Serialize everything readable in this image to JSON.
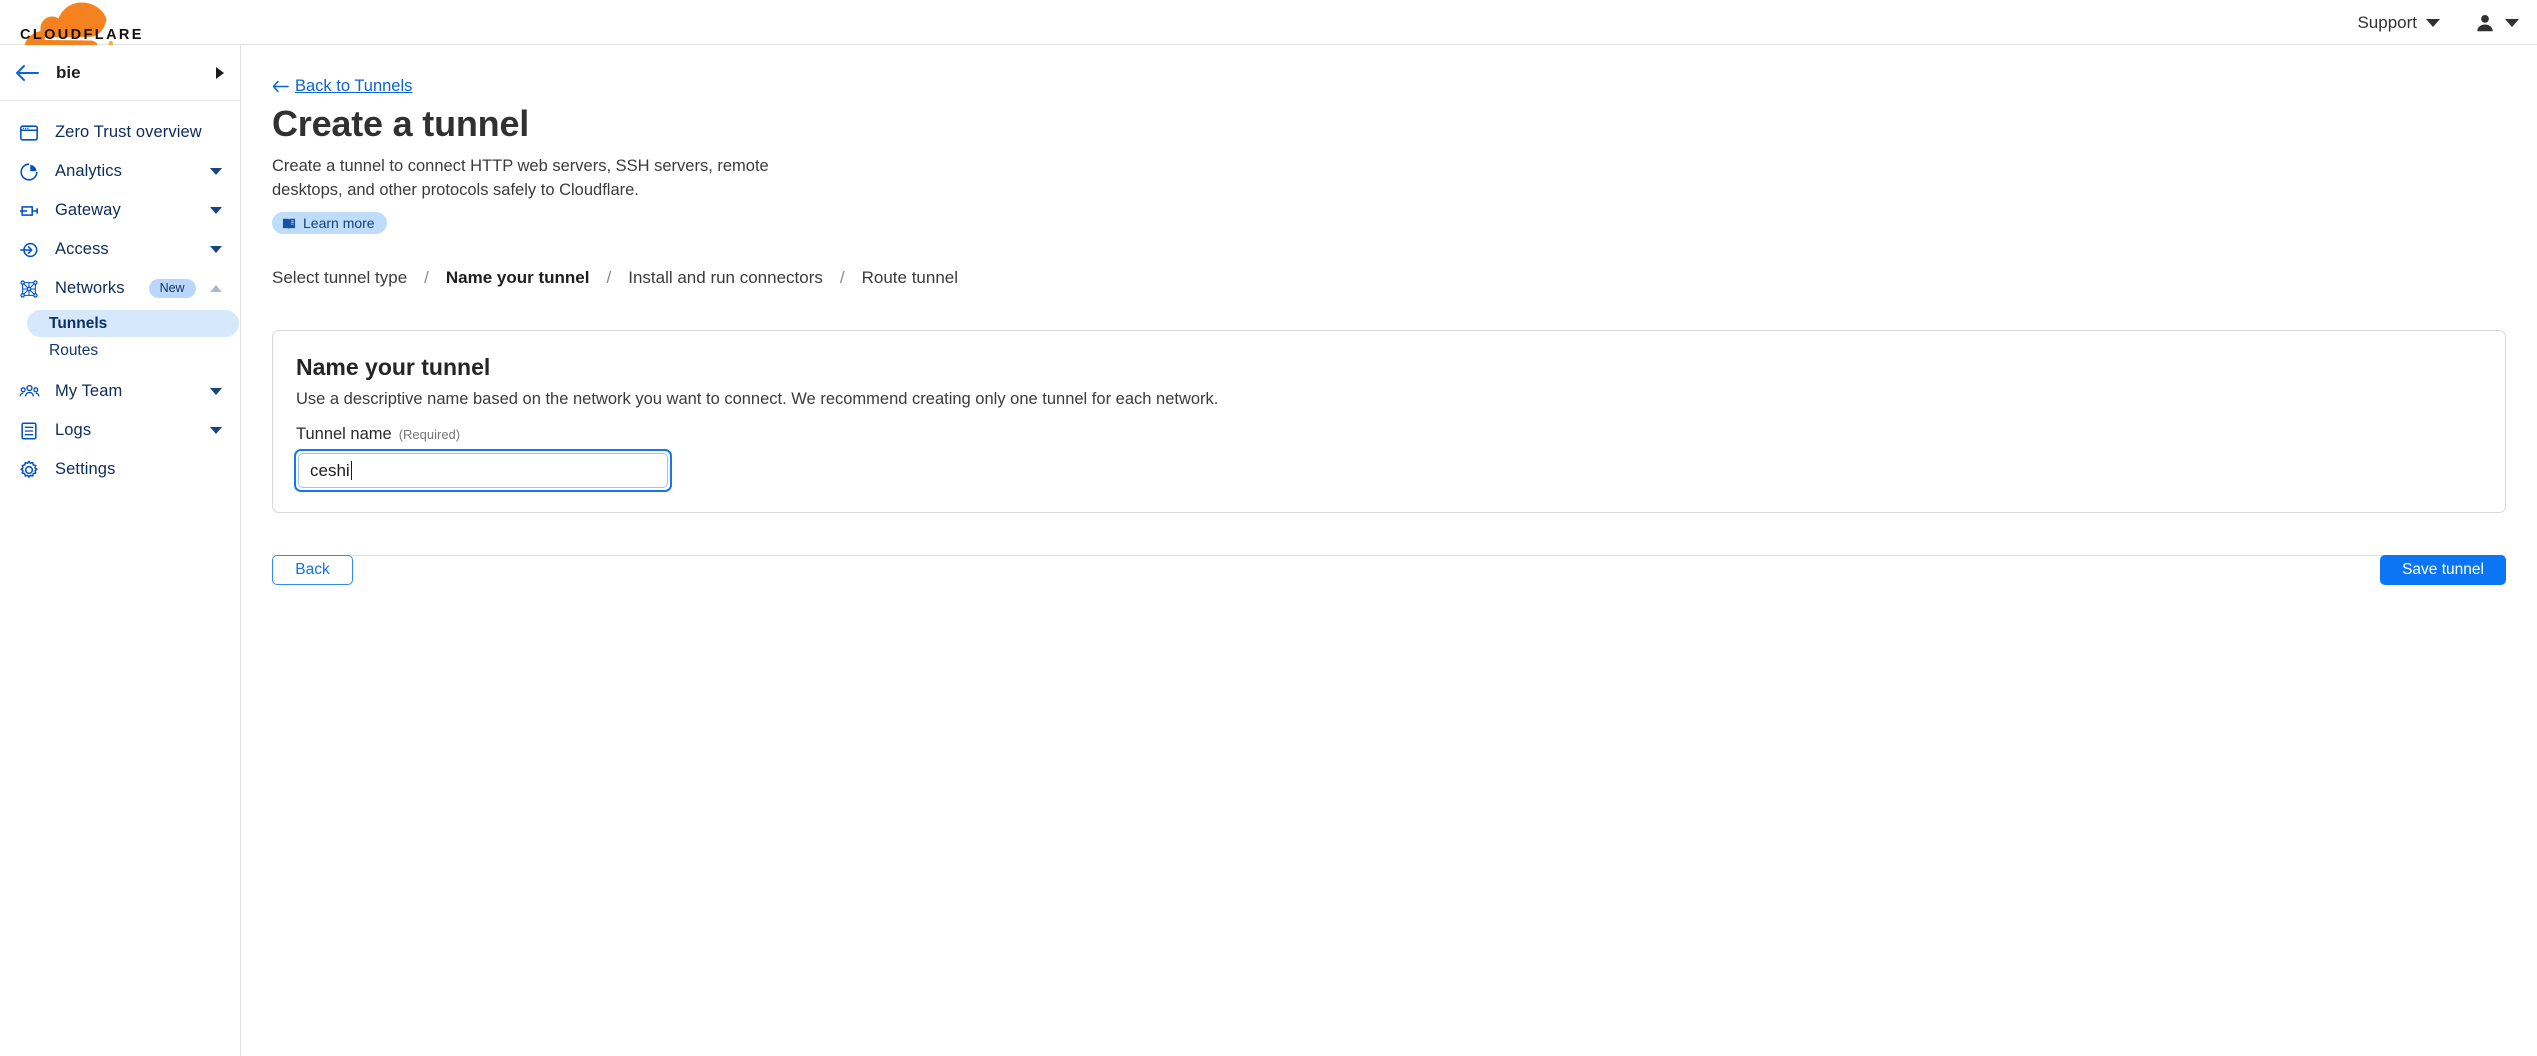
{
  "header": {
    "logo_alt": "Cloudflare",
    "wordmark": "CLOUDFLARE",
    "support_label": "Support",
    "support_caret": "chevron-down-icon",
    "user_icon": "user-icon",
    "user_caret": "chevron-down-icon"
  },
  "sidebar": {
    "account": {
      "back_icon": "arrow-left-icon",
      "name": "bie",
      "expand_icon": "triangle-right-icon"
    },
    "items": [
      {
        "label": "Zero Trust overview",
        "icon": "browser-window-icon",
        "expandable": false,
        "active": false
      },
      {
        "label": "Analytics",
        "icon": "pie-chart-icon",
        "expandable": true,
        "expanded": false,
        "active": false
      },
      {
        "label": "Gateway",
        "icon": "gateway-icon",
        "expandable": true,
        "expanded": false,
        "active": false
      },
      {
        "label": "Access",
        "icon": "access-arrow-circle-icon",
        "expandable": true,
        "expanded": false,
        "active": false
      },
      {
        "label": "Networks",
        "icon": "network-nodes-icon",
        "badge": "New",
        "expandable": true,
        "expanded": true,
        "active": false
      },
      {
        "label": "My Team",
        "icon": "people-icon",
        "expandable": true,
        "expanded": false,
        "active": false
      },
      {
        "label": "Logs",
        "icon": "logs-list-icon",
        "expandable": true,
        "expanded": false,
        "active": false
      },
      {
        "label": "Settings",
        "icon": "gear-icon",
        "expandable": false,
        "active": false
      }
    ],
    "networks_subitems": [
      {
        "label": "Tunnels",
        "active": true
      },
      {
        "label": "Routes",
        "active": false
      }
    ]
  },
  "main": {
    "back_link": "Back to Tunnels",
    "back_link_icon": "arrow-left-icon",
    "title": "Create a tunnel",
    "description": "Create a tunnel to connect HTTP web servers, SSH servers, remote desktops, and other protocols safely to Cloudflare.",
    "learn_more": {
      "label": "Learn more",
      "icon": "book-icon"
    },
    "steps": [
      {
        "label": "Select tunnel type",
        "active": false
      },
      {
        "label": "Name your tunnel",
        "active": true
      },
      {
        "label": "Install and run connectors",
        "active": false
      },
      {
        "label": "Route tunnel",
        "active": false
      }
    ],
    "step_separator": "/",
    "card": {
      "title": "Name your tunnel",
      "description": "Use a descriptive name based on the network you want to connect. We recommend creating only one tunnel for each network.",
      "field": {
        "label": "Tunnel name",
        "required_hint": "(Required)",
        "value": "ceshi",
        "placeholder": "",
        "focused": true
      }
    },
    "footer": {
      "back_button": "Back",
      "save_button": "Save tunnel"
    }
  },
  "colors": {
    "brand_orange": "#f6821f",
    "brand_orange_light": "#fbad41",
    "link_blue": "#0b63d6",
    "primary_blue": "#0b76f5",
    "nav_icon_blue": "#0051c3",
    "nav_text_navy": "#0c2c5c",
    "active_pill_blue": "#d6e8fc",
    "badge_blue": "#bad7fb"
  }
}
